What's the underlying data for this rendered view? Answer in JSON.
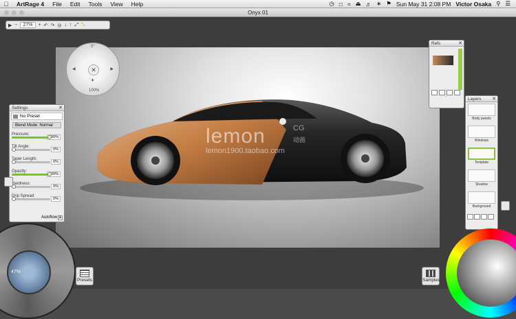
{
  "menubar": {
    "apple": "",
    "app_name": "ArtRage 4",
    "items": [
      "File",
      "Edit",
      "Tools",
      "View",
      "Help"
    ],
    "datetime": "Sun May 31  2:08 PM",
    "user": "Victor Osaka"
  },
  "window": {
    "title": "Onyx 01"
  },
  "toolbar": {
    "zoom": "27%"
  },
  "nav_wheel": {
    "top": "0°",
    "bottom": "100%",
    "center": "✕",
    "plus": "+"
  },
  "settings": {
    "title": "Settings",
    "preset": "No Preset",
    "blend_mode": "Blend Mode: Normal",
    "rows": [
      {
        "label": "Pressure:",
        "value": "100%",
        "fraction": 1.0
      },
      {
        "label": "Tilt Angle:",
        "value": "0%",
        "fraction": 0.0
      },
      {
        "label": "Taper Length:",
        "value": "0%",
        "fraction": 0.0
      },
      {
        "label": "Opacity:",
        "value": "100%",
        "fraction": 1.0
      },
      {
        "label": "Hardness:",
        "value": "0%",
        "fraction": 0.0
      },
      {
        "label": "Drip Spread:",
        "value": "0%",
        "fraction": 0.0
      }
    ],
    "autoflow": "Autoflow"
  },
  "refs": {
    "title": "Refs"
  },
  "layers": {
    "title": "Layers",
    "items": [
      {
        "name": "Body panels",
        "active": false
      },
      {
        "name": "Windows",
        "active": false
      },
      {
        "name": "Template",
        "active": true
      },
      {
        "name": "Shadow",
        "active": false
      },
      {
        "name": "Background",
        "active": false
      }
    ]
  },
  "tool_picker": {
    "size": "47%"
  },
  "buttons": {
    "presets": "Presets",
    "samples": "Samples"
  },
  "watermark": {
    "main": "lemon",
    "sub": "lemon1900.taobao.com",
    "cg": "CG",
    "cn": "动画"
  },
  "colors": {
    "accent": "#8cc33e",
    "car_copper": "#c47e45",
    "car_black": "#1e1e1e"
  }
}
